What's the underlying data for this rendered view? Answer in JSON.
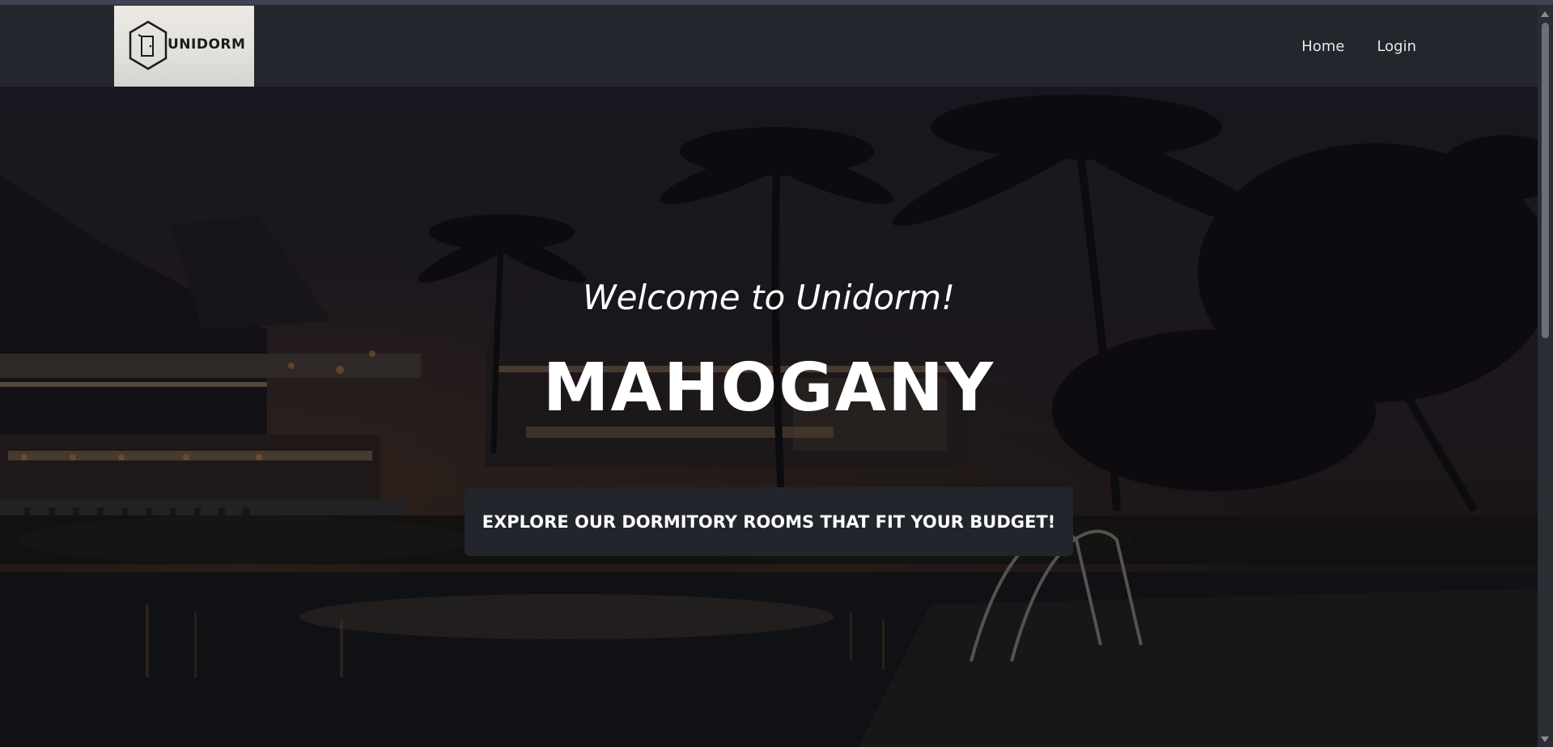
{
  "brand": {
    "name": "UNIDORM",
    "logo_icon": "door-hexagon-icon"
  },
  "nav": {
    "items": [
      {
        "label": "Home"
      },
      {
        "label": "Login"
      }
    ]
  },
  "hero": {
    "welcome": "Welcome to Unidorm!",
    "title": "MAHOGANY",
    "cta_label": "EXPLORE OUR DORMITORY ROOMS THAT FIT YOUR BUDGET!"
  },
  "colors": {
    "navbar_bg": "#23262c",
    "cta_bg": "#22252b",
    "text": "#ffffff"
  }
}
